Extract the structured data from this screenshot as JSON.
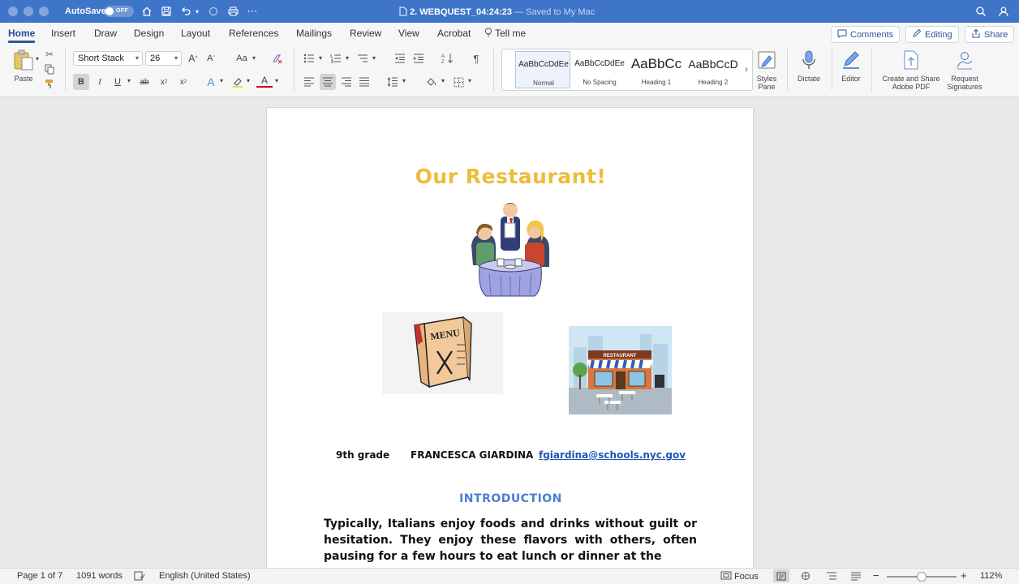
{
  "titlebar": {
    "autosave_label": "AutoSave",
    "autosave_state": "OFF",
    "doc_name": "2. WEBQUEST_04:24:23",
    "saved_status": "— Saved to My Mac"
  },
  "tabs": [
    "Home",
    "Insert",
    "Draw",
    "Design",
    "Layout",
    "References",
    "Mailings",
    "Review",
    "View",
    "Acrobat"
  ],
  "tell_me": "Tell me",
  "top_actions": {
    "comments": "Comments",
    "editing": "Editing",
    "share": "Share"
  },
  "ribbon": {
    "paste": "Paste",
    "font_name": "Short Stack",
    "font_size": "26",
    "styles": [
      {
        "sample": "AaBbCcDdEe",
        "name": "Normal"
      },
      {
        "sample": "AaBbCcDdEe",
        "name": "No Spacing"
      },
      {
        "sample": "AaBbCc",
        "name": "Heading 1"
      },
      {
        "sample": "AaBbCcD",
        "name": "Heading 2"
      }
    ],
    "styles_pane": "Styles Pane",
    "dictate": "Dictate",
    "editor": "Editor",
    "create_share_pdf": "Create and Share Adobe PDF",
    "request_signatures": "Request Signatures"
  },
  "document": {
    "title": "Our Restaurant!",
    "grade": "9th grade",
    "author": "FRANCESCA GIARDINA",
    "email": "fgiardina@schools.nyc.gov",
    "intro_heading": "INTRODUCTION",
    "intro_text": "Typically, Italians enjoy foods and drinks without guilt or hesitation. They enjoy these flavors with others, often pausing for a few hours to eat lunch or dinner at the",
    "menu_sign": "MENU",
    "restaurant_sign": "RESTAURANT"
  },
  "statusbar": {
    "page": "Page 1 of 7",
    "words": "1091 words",
    "language": "English (United States)",
    "focus": "Focus",
    "zoom": "112%"
  },
  "colors": {
    "titlebar": "#3f75c8",
    "doc_title": "#efbb3a",
    "heading": "#4a7fd0",
    "link": "#1f56b5"
  }
}
